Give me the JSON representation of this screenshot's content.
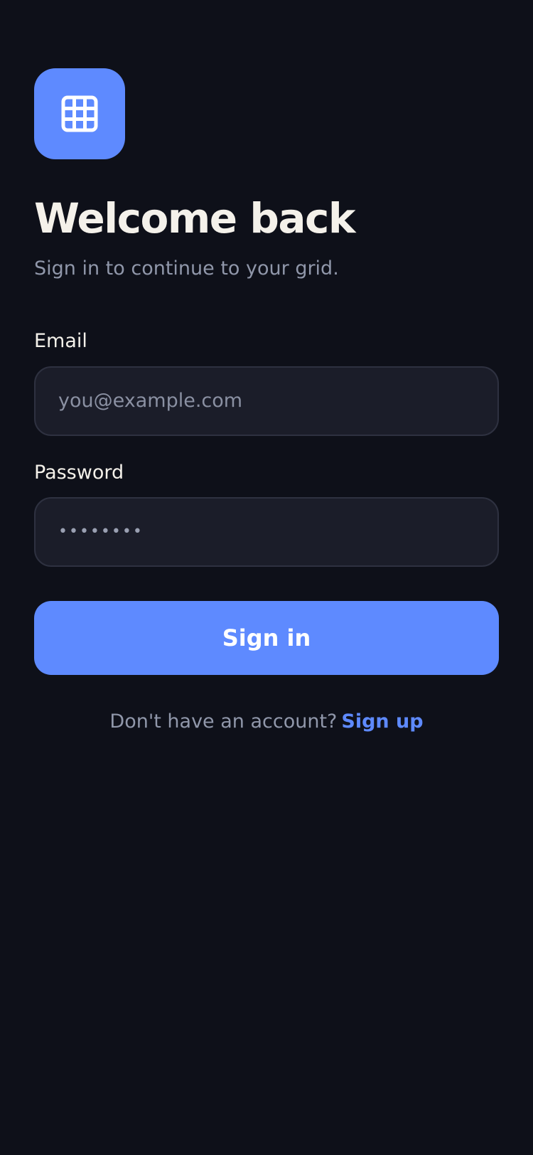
{
  "app": {
    "logo_icon": "grid-icon",
    "accent_color": "#5e8aff",
    "background_color": "#0e1019"
  },
  "header": {
    "title": "Welcome back",
    "subtitle": "Sign in to continue to your grid."
  },
  "form": {
    "email": {
      "label": "Email",
      "placeholder": "you@example.com",
      "value": ""
    },
    "password": {
      "label": "Password",
      "value": "••••••••"
    },
    "submit_label": "Sign in"
  },
  "footer": {
    "prompt": "Don't have an account?",
    "link_label": "Sign up"
  }
}
